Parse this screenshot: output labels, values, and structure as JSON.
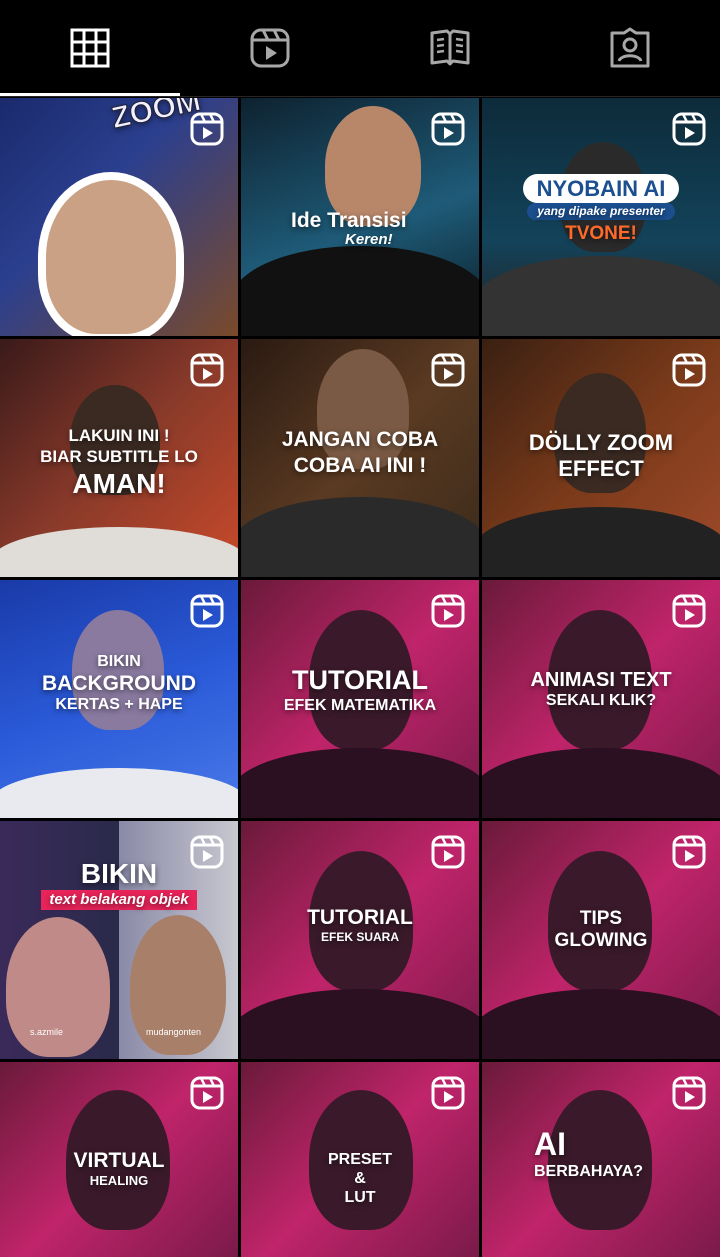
{
  "tabs": [
    {
      "name": "posts-grid",
      "icon": "grid-icon",
      "active": true
    },
    {
      "name": "reels",
      "icon": "reels-icon",
      "active": false
    },
    {
      "name": "guides",
      "icon": "guide-icon",
      "active": false
    },
    {
      "name": "tagged",
      "icon": "tagged-person-icon",
      "active": false
    }
  ],
  "tiles": [
    {
      "type": "reel",
      "lines": [
        "ZOOM"
      ]
    },
    {
      "type": "reel",
      "lines": [
        "Ide Transisi",
        "Keren!"
      ]
    },
    {
      "type": "reel",
      "lines": [
        "NYOBAIN AI",
        "yang dipake presenter",
        "TVONE!"
      ]
    },
    {
      "type": "reel",
      "lines": [
        "LAKUIN INI !",
        "BIAR SUBTITLE LO",
        "AMAN!"
      ]
    },
    {
      "type": "reel",
      "lines": [
        "JANGAN COBA",
        "COBA AI INI !"
      ]
    },
    {
      "type": "reel",
      "lines": [
        "DÖLLY ZOOM",
        "EFFECT"
      ]
    },
    {
      "type": "reel",
      "lines": [
        "BIKIN",
        "BACKGROUND",
        "KERTAS + HAPE"
      ]
    },
    {
      "type": "reel",
      "lines": [
        "TUTORIAL",
        "EFEK MATEMATIKA"
      ]
    },
    {
      "type": "reel",
      "lines": [
        "ANIMASI TEXT",
        "SEKALI KLIK?"
      ]
    },
    {
      "type": "reel",
      "lines": [
        "BIKIN",
        "text belakang objek"
      ],
      "tags": [
        "s.azmile",
        "mudangonten"
      ]
    },
    {
      "type": "reel",
      "lines": [
        "TUTORIAL",
        "EFEK SUARA"
      ]
    },
    {
      "type": "reel",
      "lines": [
        "TIPS",
        "GLOWING"
      ]
    },
    {
      "type": "reel",
      "lines": [
        "VIRTUAL",
        "HEALING"
      ]
    },
    {
      "type": "reel",
      "lines": [
        "PRESET",
        "&",
        "LUT"
      ]
    },
    {
      "type": "reel",
      "lines": [
        "AI",
        "BERBAHAYA?"
      ]
    }
  ]
}
